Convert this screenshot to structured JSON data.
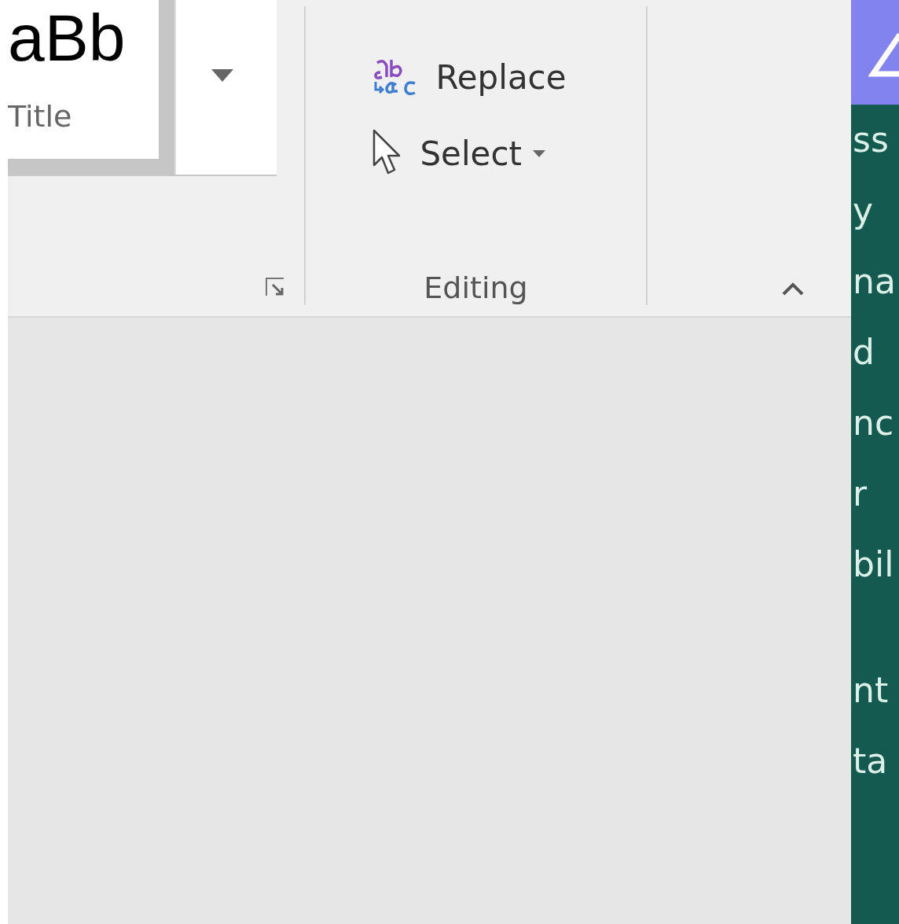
{
  "styles_gallery": {
    "style_preview": "aBb",
    "style_name": "Title"
  },
  "editing_group": {
    "buttons": [
      {
        "kind": "replace",
        "label": "Replace"
      },
      {
        "kind": "select",
        "label": "Select"
      }
    ],
    "label": "Editing"
  },
  "side_panel": {
    "lines": [
      {
        "text": "ss",
        "gap_before": false
      },
      {
        "text": "y",
        "gap_before": false
      },
      {
        "text": "na",
        "gap_before": false
      },
      {
        "text": "d",
        "gap_before": false
      },
      {
        "text": "nc",
        "gap_before": false
      },
      {
        "text": "r",
        "gap_before": false
      },
      {
        "text": "bil",
        "gap_before": false
      },
      {
        "text": "nt",
        "gap_before": true
      },
      {
        "text": "ta",
        "gap_before": false
      }
    ]
  }
}
